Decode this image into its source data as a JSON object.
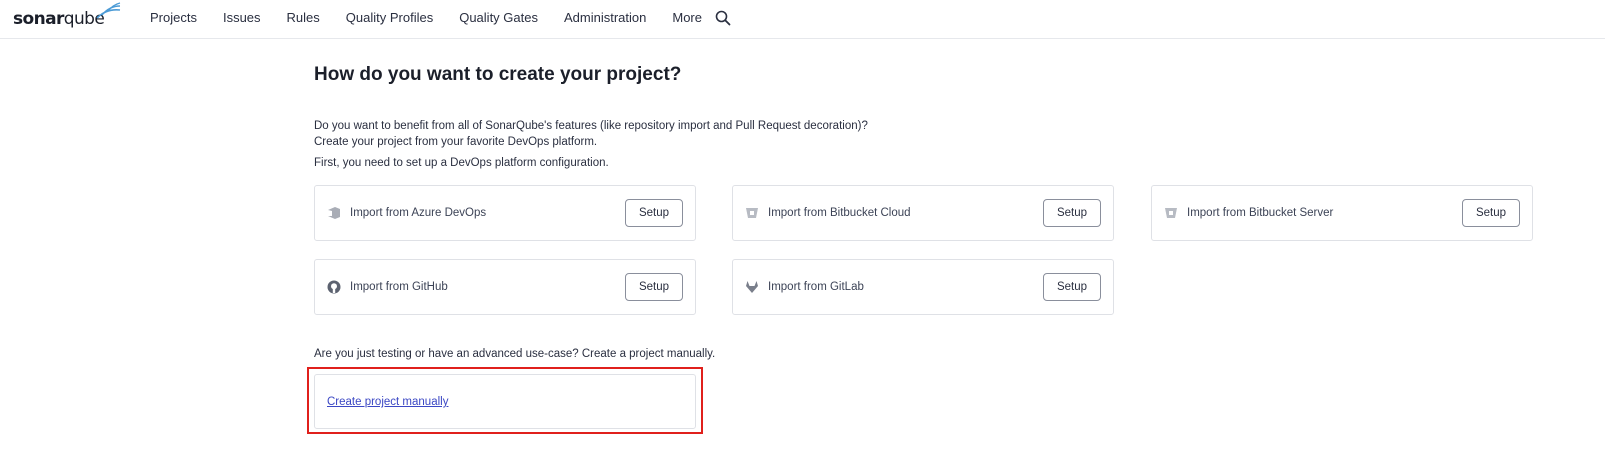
{
  "header": {
    "logo_bold": "sonar",
    "logo_light": "qube",
    "nav": [
      {
        "label": "Projects"
      },
      {
        "label": "Issues"
      },
      {
        "label": "Rules"
      },
      {
        "label": "Quality Profiles"
      },
      {
        "label": "Quality Gates"
      },
      {
        "label": "Administration"
      },
      {
        "label": "More"
      }
    ],
    "search_icon": "search-icon"
  },
  "main": {
    "title": "How do you want to create your project?",
    "intro_line1": "Do you want to benefit from all of SonarQube's features (like repository import and Pull Request decoration)?",
    "intro_line2": "Create your project from your favorite DevOps platform.",
    "intro_line3": "First, you need to set up a DevOps platform configuration.",
    "platforms": [
      {
        "label": "Import from Azure DevOps",
        "button": "Setup",
        "icon": "azure-devops-icon"
      },
      {
        "label": "Import from Bitbucket Cloud",
        "button": "Setup",
        "icon": "bitbucket-icon"
      },
      {
        "label": "Import from Bitbucket Server",
        "button": "Setup",
        "icon": "bitbucket-icon"
      },
      {
        "label": "Import from GitHub",
        "button": "Setup",
        "icon": "github-icon"
      },
      {
        "label": "Import from GitLab",
        "button": "Setup",
        "icon": "gitlab-icon"
      }
    ],
    "manual_prompt": "Are you just testing or have an advanced use-case? Create a project manually.",
    "manual_link": "Create project manually"
  },
  "colors": {
    "accent_link": "#3b47c4",
    "highlight": "#e0201c",
    "border": "#dfe1e6"
  }
}
